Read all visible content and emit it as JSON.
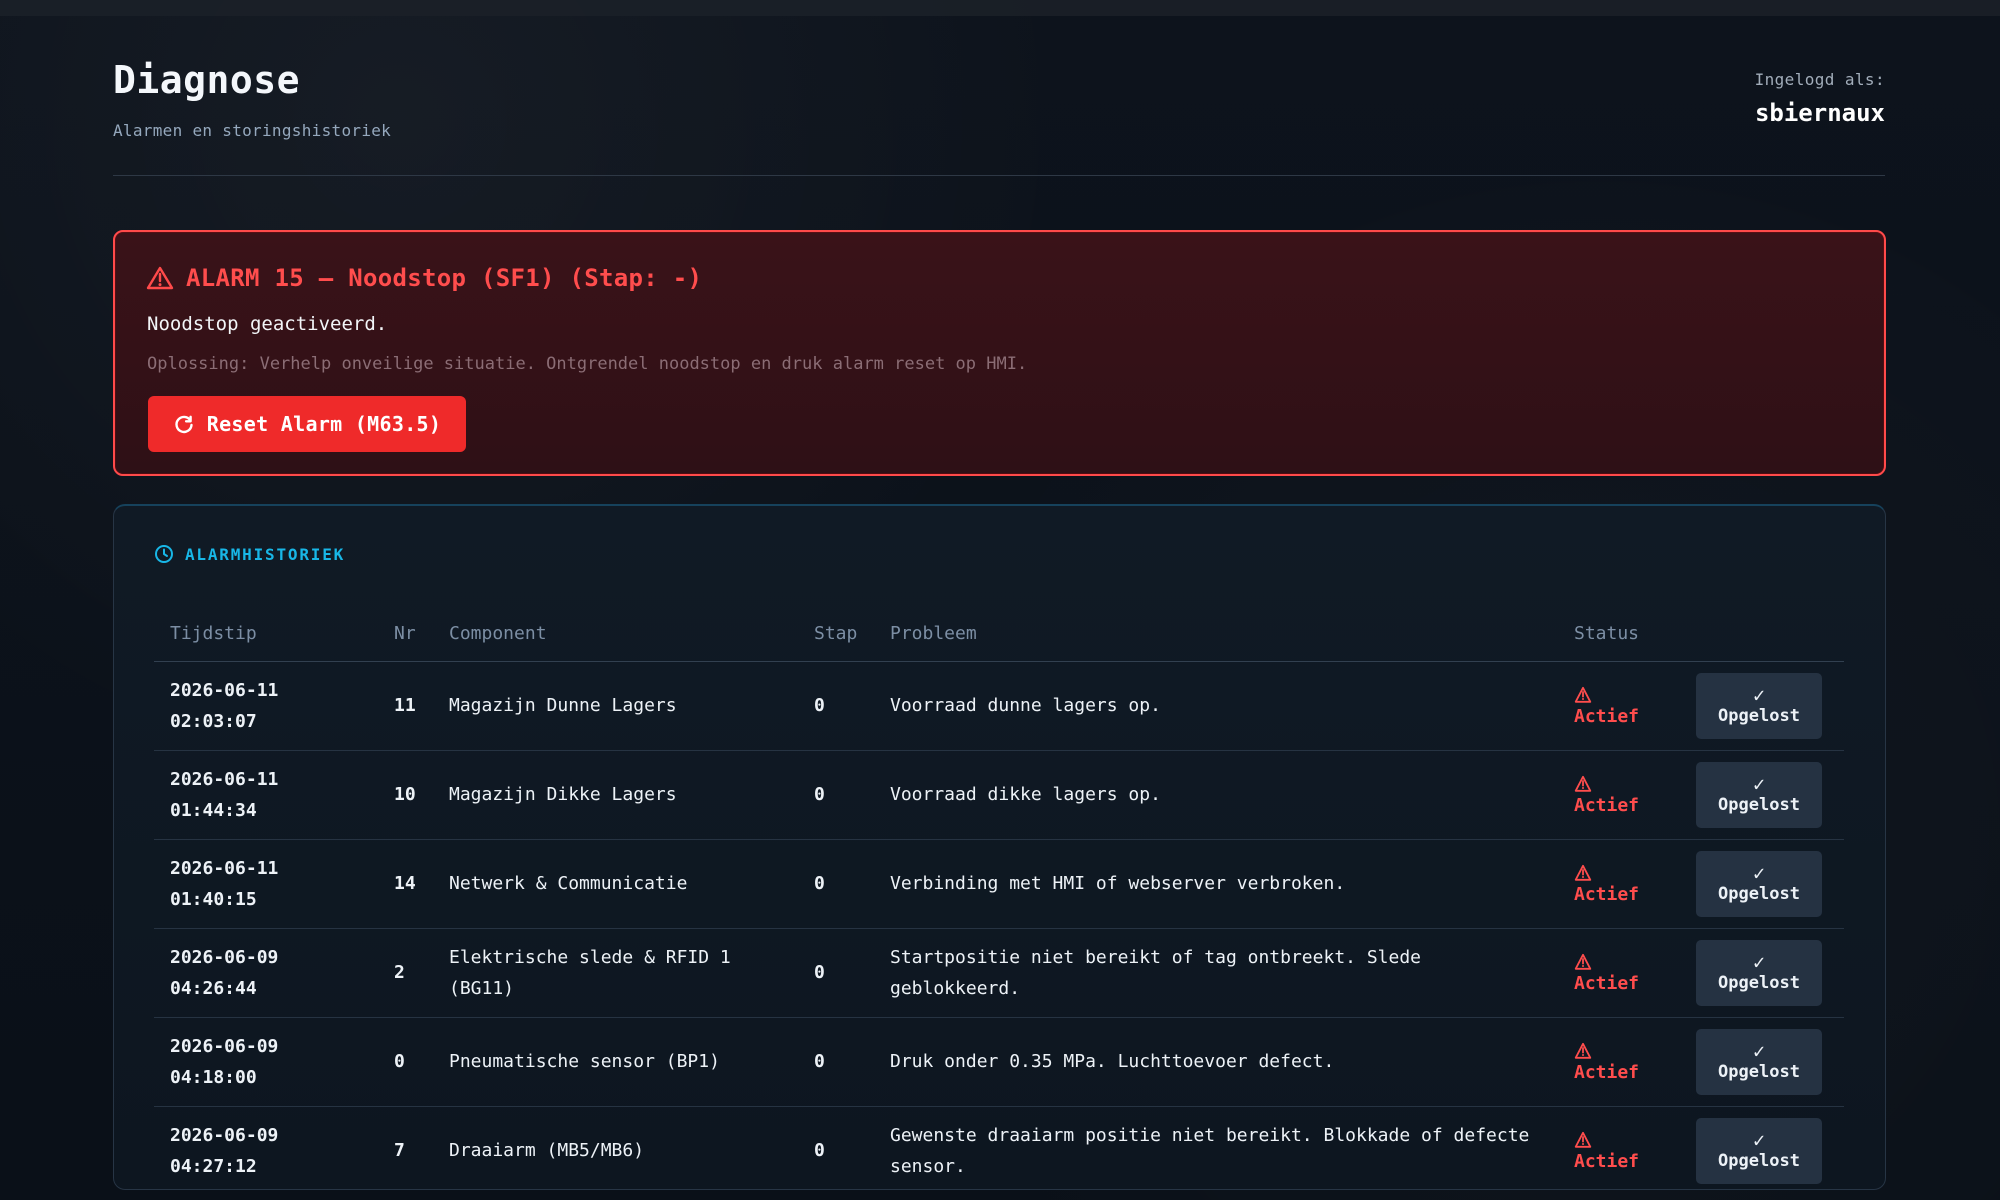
{
  "header": {
    "title": "Diagnose",
    "subtitle": "Alarmen en storingshistoriek",
    "login_label": "Ingelogd als:",
    "login_user": "sbiernaux"
  },
  "alarm": {
    "title": "ALARM 15 – Noodstop (SF1) (Stap: -)",
    "message": "Noodstop geactiveerd.",
    "solution": "Oplossing: Verhelp onveilige situatie. Ontgrendel noodstop en druk alarm reset op HMI.",
    "button_label": "Reset Alarm (M63.5)",
    "alarm_icon": "warning-triangle-icon",
    "reset_icon": "refresh-icon",
    "accent": "#ff4a4a"
  },
  "history": {
    "title": "ALARMHISTORIEK",
    "icon": "clock-icon",
    "columns": [
      "Tijdstip",
      "Nr",
      "Component",
      "Stap",
      "Probleem",
      "Status"
    ],
    "rows": [
      {
        "time": "2026-06-11\n02:03:07",
        "nr": "11",
        "component": "Magazijn Dunne Lagers",
        "step": "0",
        "problem": "Voorraad dunne lagers op.",
        "status": "Actief",
        "action_label": "Opgelost"
      },
      {
        "time": "2026-06-11\n01:44:34",
        "nr": "10",
        "component": "Magazijn Dikke Lagers",
        "step": "0",
        "problem": "Voorraad dikke lagers op.",
        "status": "Actief",
        "action_label": "Opgelost"
      },
      {
        "time": "2026-06-11\n01:40:15",
        "nr": "14",
        "component": "Netwerk & Communicatie",
        "step": "0",
        "problem": "Verbinding met HMI of webserver verbroken.",
        "status": "Actief",
        "action_label": "Opgelost"
      },
      {
        "time": "2026-06-09\n04:26:44",
        "nr": "2",
        "component": "Elektrische slede & RFID 1 (BG11)",
        "step": "0",
        "problem": "Startpositie niet bereikt of tag ontbreekt. Slede geblokkeerd.",
        "status": "Actief",
        "action_label": "Opgelost"
      },
      {
        "time": "2026-06-09\n04:18:00",
        "nr": "0",
        "component": "Pneumatische sensor (BP1)",
        "step": "0",
        "problem": "Druk onder 0.35 MPa. Luchttoevoer defect.",
        "status": "Actief",
        "action_label": "Opgelost"
      },
      {
        "time": "2026-06-09\n04:27:12",
        "nr": "7",
        "component": "Draaiarm (MB5/MB6)",
        "step": "0",
        "problem": "Gewenste draaiarm positie niet bereikt. Blokkade of defecte sensor.",
        "status": "Actief",
        "action_label": "Opgelost"
      }
    ],
    "status_icon": "warning-triangle-icon",
    "action_icon": "check-icon",
    "status_color": "#ff4d4d",
    "accent": "#18b7e7"
  }
}
